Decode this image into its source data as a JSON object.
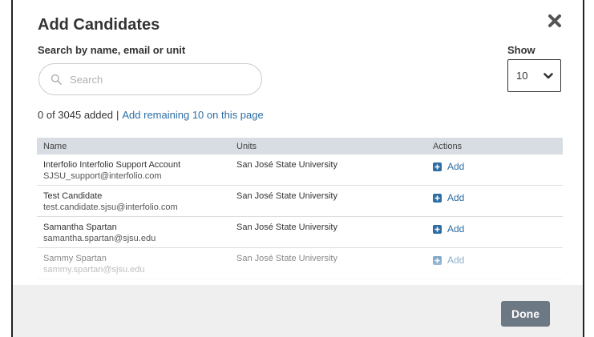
{
  "modal": {
    "title": "Add Candidates",
    "close_icon": "close-icon"
  },
  "search": {
    "label": "Search by name, email or unit",
    "placeholder": "Search",
    "value": ""
  },
  "show": {
    "label": "Show",
    "selected": "10"
  },
  "summary": {
    "count_text": "0 of 3045 added",
    "separator": "|",
    "add_remaining_link": "Add remaining 10 on this page"
  },
  "table": {
    "headers": {
      "name": "Name",
      "units": "Units",
      "actions": "Actions"
    },
    "rows": [
      {
        "name": "Interfolio Interfolio Support Account",
        "email": "SJSU_support@interfolio.com",
        "unit": "San José State University",
        "action": "Add"
      },
      {
        "name": "Test Candidate",
        "email": "test.candidate.sjsu@interfolio.com",
        "unit": "San José State University",
        "action": "Add"
      },
      {
        "name": "Samantha Spartan",
        "email": "samantha.spartan@sjsu.edu",
        "unit": "San José State University",
        "action": "Add"
      },
      {
        "name": "Sammy Spartan",
        "email": "sammy.spartan@sjsu.edu",
        "unit": "San José State University",
        "action": "Add"
      }
    ]
  },
  "footer": {
    "done_label": "Done"
  },
  "colors": {
    "link": "#2e6da4",
    "table_header_bg": "#d7dde3",
    "footer_bg": "#efefef",
    "done_button_bg": "#6c7884"
  }
}
